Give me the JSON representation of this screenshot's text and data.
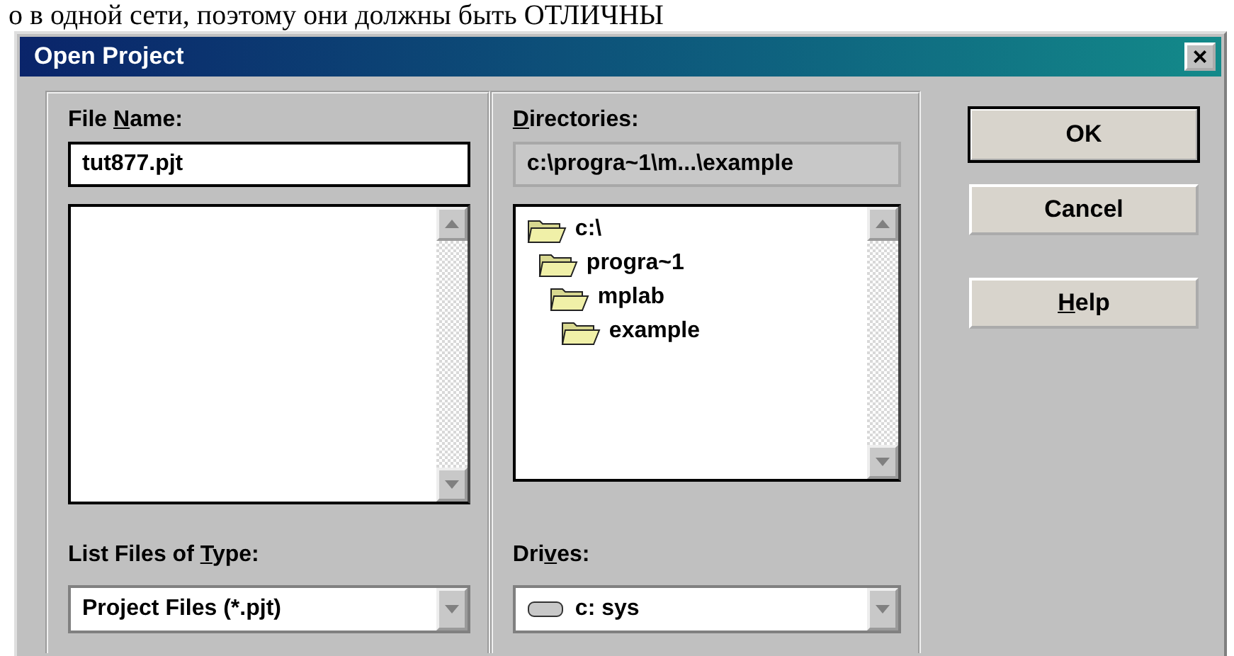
{
  "document_text": "о в одной сети, поэтому они должны быть ОТЛИЧНЫ",
  "window": {
    "title": "Open Project",
    "close": "×"
  },
  "file_name": {
    "label": {
      "pre": "File ",
      "key": "N",
      "post": "ame:"
    },
    "value": "tut877.pjt"
  },
  "directories": {
    "label": {
      "key": "D",
      "post": "irectories:"
    },
    "path": "c:\\progra~1\\m...\\example",
    "tree": [
      {
        "name": "c:\\",
        "children": [
          {
            "name": "progra~1",
            "children": [
              {
                "name": "mplab",
                "children": [
                  {
                    "name": "example"
                  }
                ]
              }
            ]
          }
        ]
      }
    ]
  },
  "file_type": {
    "label": {
      "pre": "List Files of ",
      "key": "T",
      "post": "ype:"
    },
    "value": "Project Files (*.pjt)"
  },
  "drives": {
    "label": {
      "pre": "Dri",
      "key": "v",
      "post": "es:"
    },
    "value": "c:  sys"
  },
  "buttons": [
    {
      "label": {
        "post": "OK"
      },
      "default": true
    },
    {
      "label": {
        "post": "Cancel"
      },
      "default": false
    },
    {
      "label": {
        "key": "H",
        "post": "elp"
      },
      "default": false
    }
  ]
}
